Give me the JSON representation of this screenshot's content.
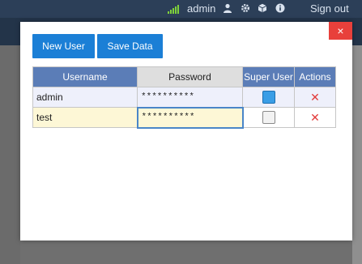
{
  "topbar": {
    "username": "admin",
    "signout_label": "Sign out",
    "colors": {
      "bg": "#2c3f58",
      "signal": "#7fd13a"
    }
  },
  "modal": {
    "close_glyph": "×",
    "buttons": {
      "new_user": "New User",
      "save_data": "Save Data"
    },
    "table": {
      "headers": [
        "Username",
        "Password",
        "Super User",
        "Actions"
      ],
      "rows": [
        {
          "username": "admin",
          "password": "**********",
          "super_user": true
        },
        {
          "username": "test",
          "password": "**********",
          "super_user": false
        }
      ],
      "delete_glyph": "✕"
    },
    "colors": {
      "button": "#1b7fd6",
      "header": "#5b7db7",
      "delete": "#e23b3b",
      "close": "#e8403b"
    }
  },
  "icons": [
    "signal-bars-icon",
    "user-icon",
    "gear-icon",
    "cube-icon",
    "info-icon"
  ]
}
